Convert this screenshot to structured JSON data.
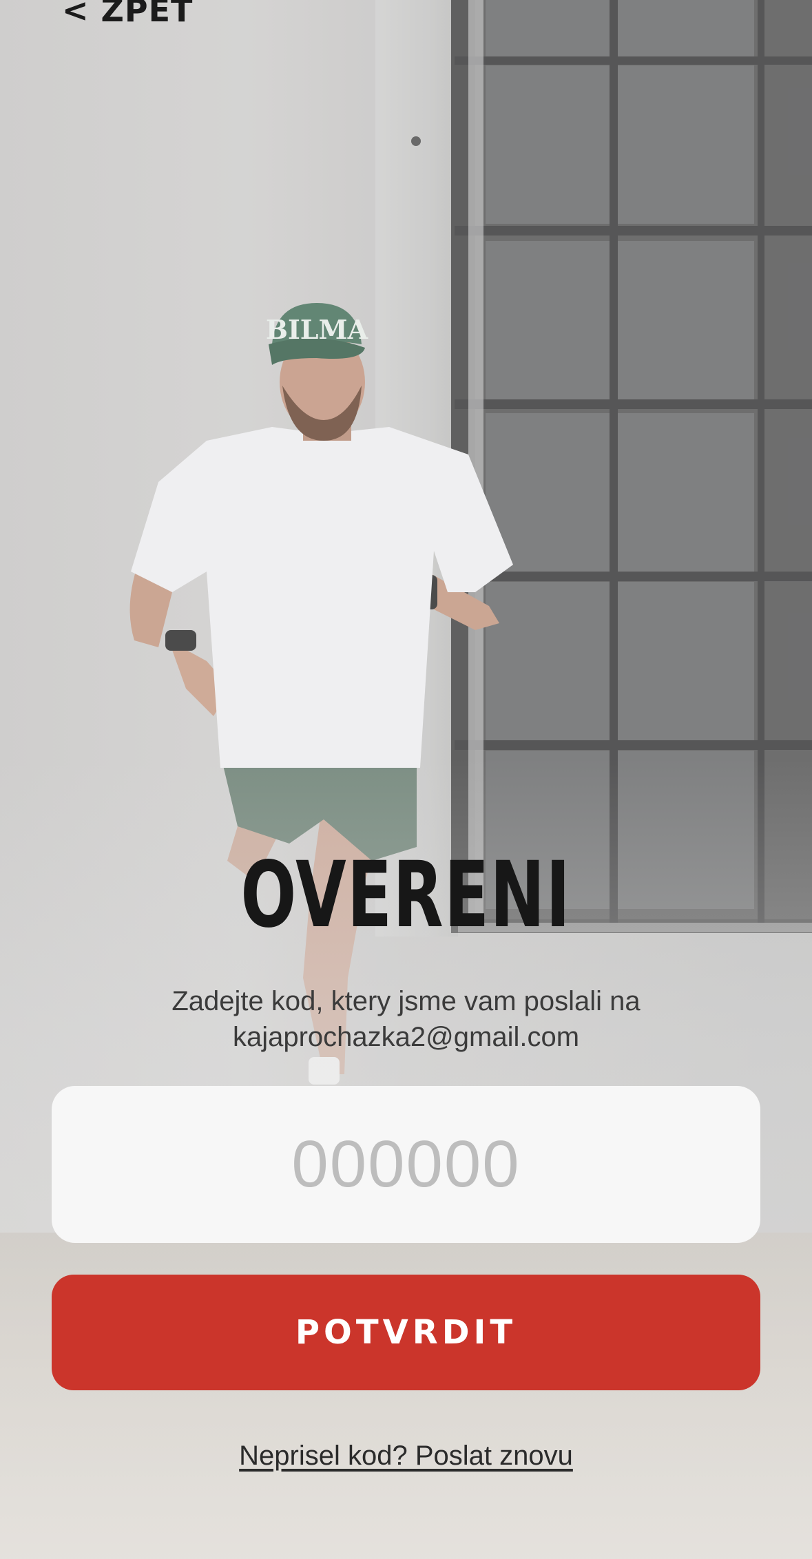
{
  "nav": {
    "back_label": "< ZPET"
  },
  "screen": {
    "title": "OVERENI",
    "subtitle_line1": "Zadejte kod, ktery jsme vam poslali na",
    "subtitle_line2": "kajaprochazka2@gmail.com"
  },
  "code_input": {
    "value": "",
    "placeholder": "000000"
  },
  "actions": {
    "confirm_label": "POTVRDIT",
    "resend_label": "Neprisel kod? Poslat znovu"
  },
  "background": {
    "cap_text": "BILMA"
  },
  "colors": {
    "accent": "#cb352b",
    "title": "#171717",
    "input_bg": "#f7f7f7",
    "placeholder": "#bdbdbd"
  }
}
